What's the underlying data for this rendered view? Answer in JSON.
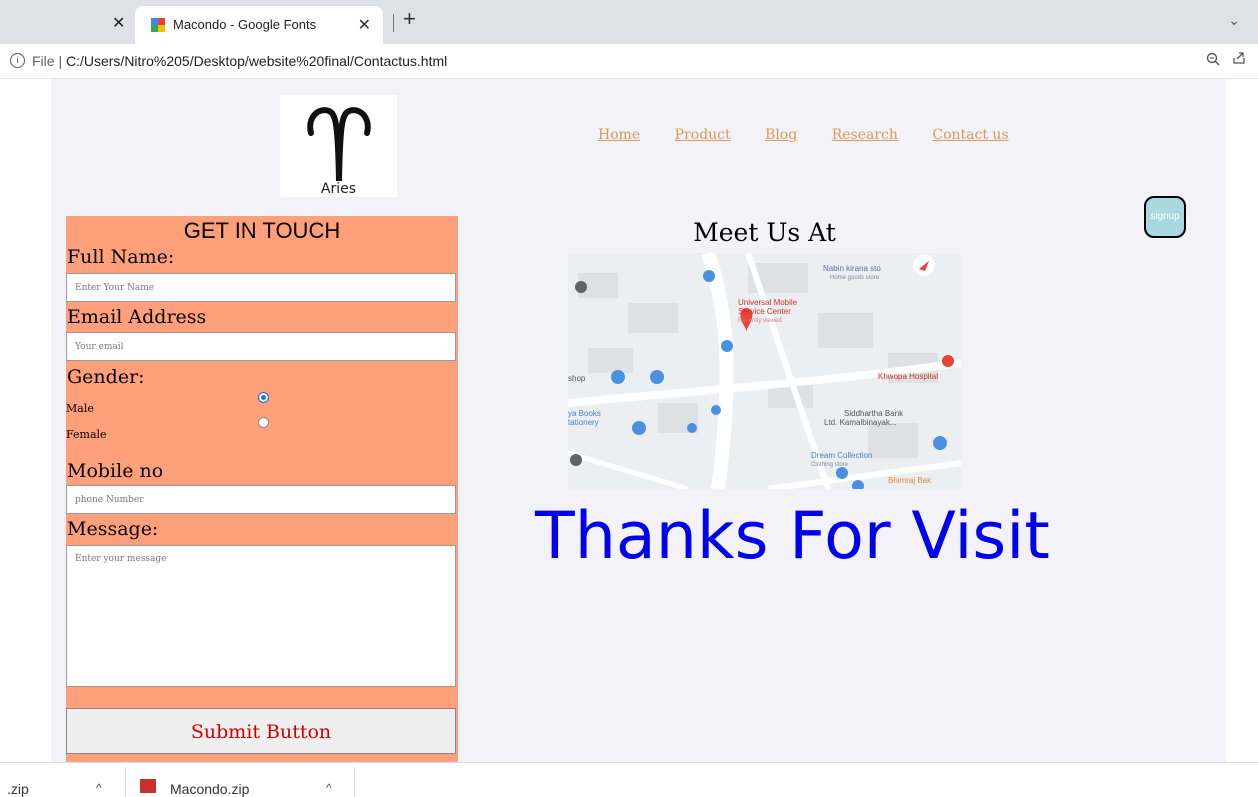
{
  "browser": {
    "tab_title": "Macondo - Google Fonts",
    "url_prefix": "File",
    "url": "C:/Users/Nitro%205/Desktop/website%20final/Contactus.html"
  },
  "logo": {
    "text": "Aries"
  },
  "nav": {
    "items": [
      "Home",
      "Product",
      "Blog",
      "Research",
      "Contact us"
    ]
  },
  "signup": {
    "label": "signup"
  },
  "form": {
    "title": "GET IN TOUCH",
    "full_name_label": "Full Name:",
    "full_name_placeholder": "Enter Your Name",
    "email_label": "Email Address",
    "email_placeholder": "Your email",
    "gender_label": "Gender:",
    "gender_options": [
      "Male",
      "Female"
    ],
    "gender_selected": "Male",
    "mobile_label": "Mobile no",
    "mobile_placeholder": "phone Number",
    "message_label": "Message:",
    "message_placeholder": "Enter your message",
    "submit_label": "Submit Button"
  },
  "map_section": {
    "title": "Meet Us At",
    "labels": {
      "store1": "Nabin kirana sto",
      "store1_sub": "Home goods store",
      "center": "Universal Mobile",
      "center2": "Service Center",
      "center_sub": "Recently viewed",
      "hospital": "Khwopa Hospital",
      "shop": "shop",
      "books": "ya Books",
      "books2": "tationery",
      "bank": "Siddhartha Bank",
      "bank2": "Ltd. Kamalbinayak...",
      "dream": "Dream Collection",
      "dream_sub": "Clothing store",
      "bhimraj": "Bhimraj Bak"
    }
  },
  "thanks": {
    "text": "Thanks For Visit"
  },
  "downloads": {
    "item1": ".zip",
    "item2": "Macondo.zip"
  }
}
